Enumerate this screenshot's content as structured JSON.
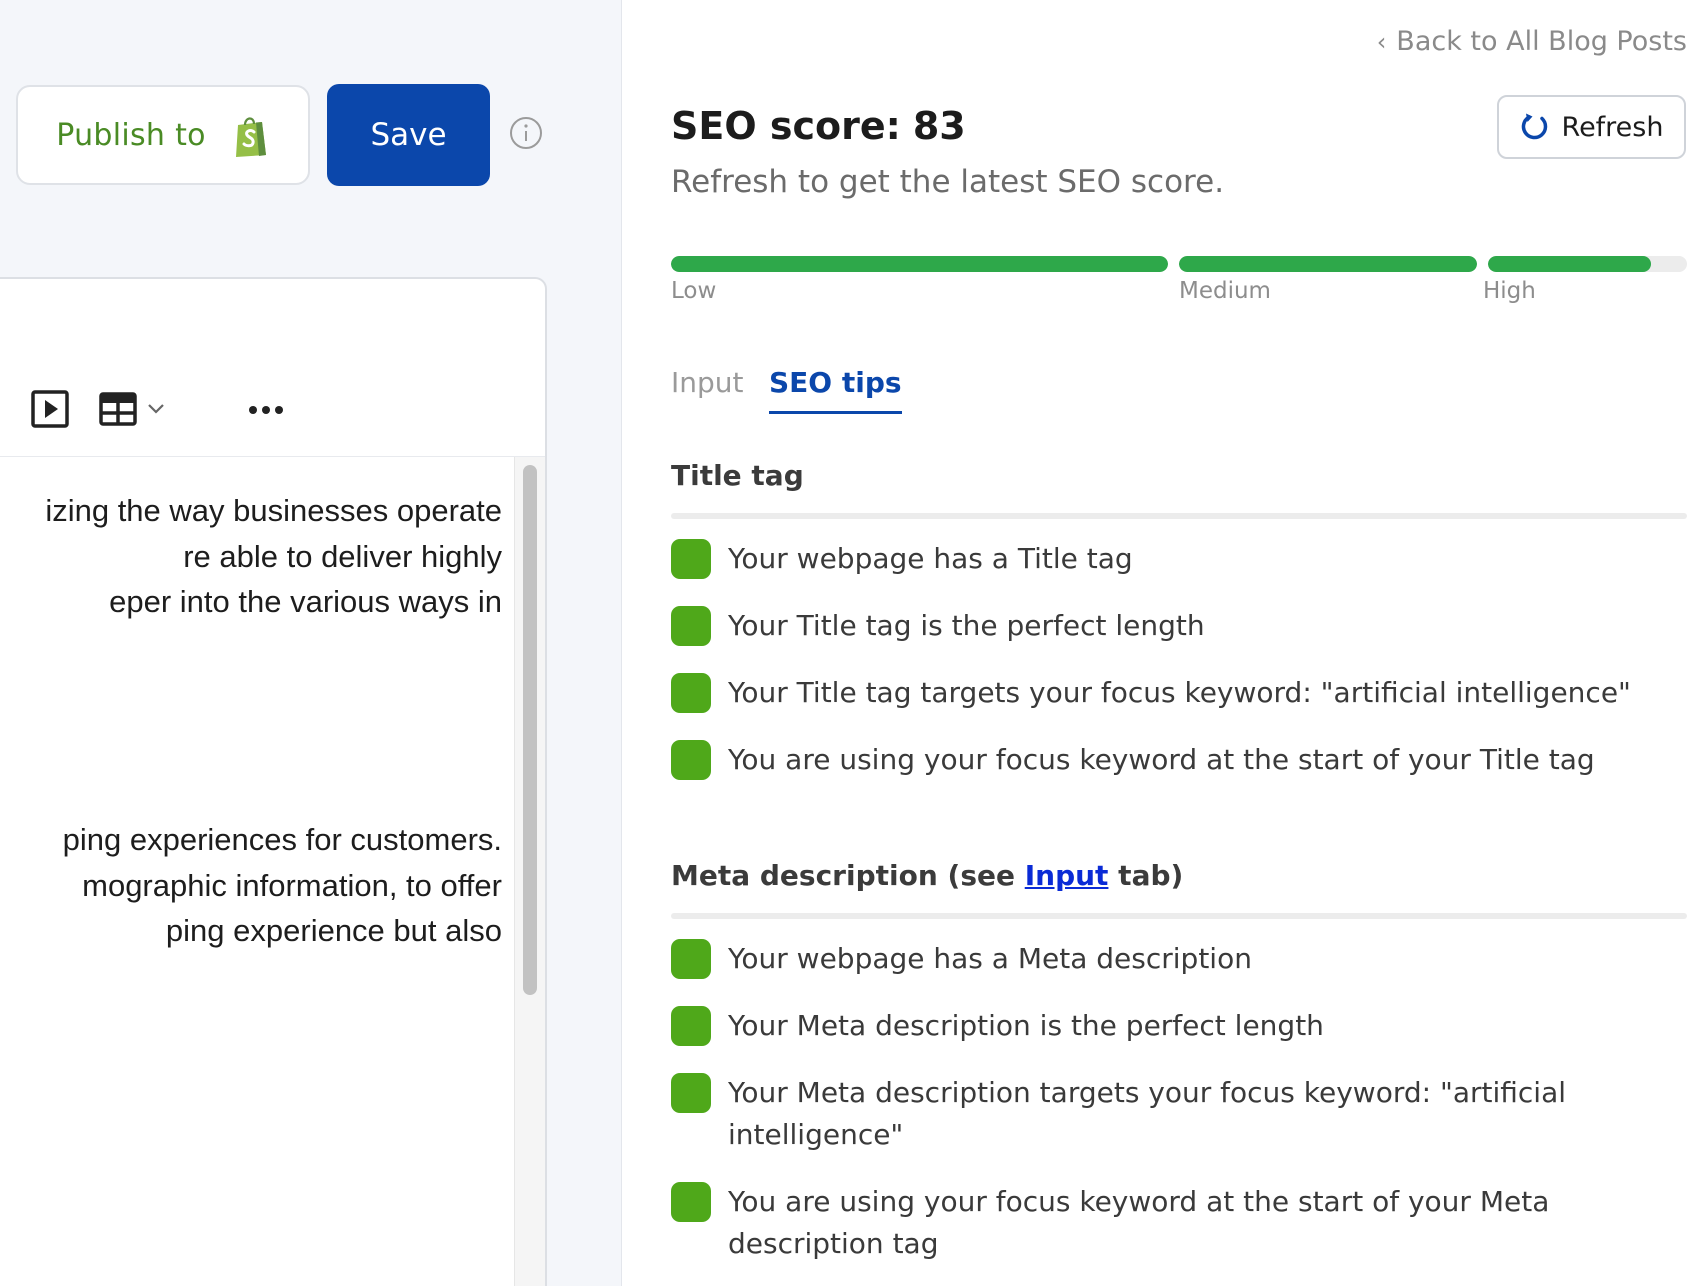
{
  "editor": {
    "publish_label": "Publish to",
    "save_label": "Save",
    "paragraph_1": [
      "izing the way businesses operate",
      "re able to deliver highly",
      "eper into the various ways in"
    ],
    "paragraph_2": [
      "ping experiences for customers.",
      "mographic information, to offer",
      "ping experience but also"
    ],
    "toolbar_icons": [
      "video-icon",
      "table-icon",
      "chevron-down-icon",
      "more-icon"
    ]
  },
  "seo_panel": {
    "back_link": "Back to All Blog Posts",
    "score_label": "SEO score:",
    "score_value": "83",
    "subtitle": "Refresh to get the latest SEO score.",
    "refresh_label": "Refresh",
    "score_bar": {
      "score": 83,
      "segments": [
        {
          "label": "Low",
          "fill": 1.0
        },
        {
          "label": "Medium",
          "fill": 1.0
        },
        {
          "label": "High",
          "fill": 0.82
        }
      ],
      "fill_color": "#2ea84a",
      "track_color": "#ececec"
    },
    "tabs": [
      {
        "label": "Input",
        "active": false
      },
      {
        "label": "SEO tips",
        "active": true
      }
    ],
    "sections": [
      {
        "title": "Title tag",
        "items": [
          "Your webpage has a Title tag",
          "Your Title tag is the perfect length",
          "Your Title tag targets your focus keyword: \"artificial intelligence\"",
          "You are using your focus keyword at the start of your Title tag"
        ]
      },
      {
        "title_prefix": "Meta description (see ",
        "title_link": "Input",
        "title_suffix": " tab)",
        "items": [
          "Your webpage has a Meta description",
          "Your Meta description is the perfect length",
          "Your Meta description targets your focus keyword: \"artificial intelligence\"",
          "You are using your focus keyword at the start of your Meta description tag"
        ]
      }
    ],
    "check_color": "#4fa81a"
  },
  "colors": {
    "brand_blue": "#0b47ab",
    "shopify_green": "#4a8b25"
  }
}
